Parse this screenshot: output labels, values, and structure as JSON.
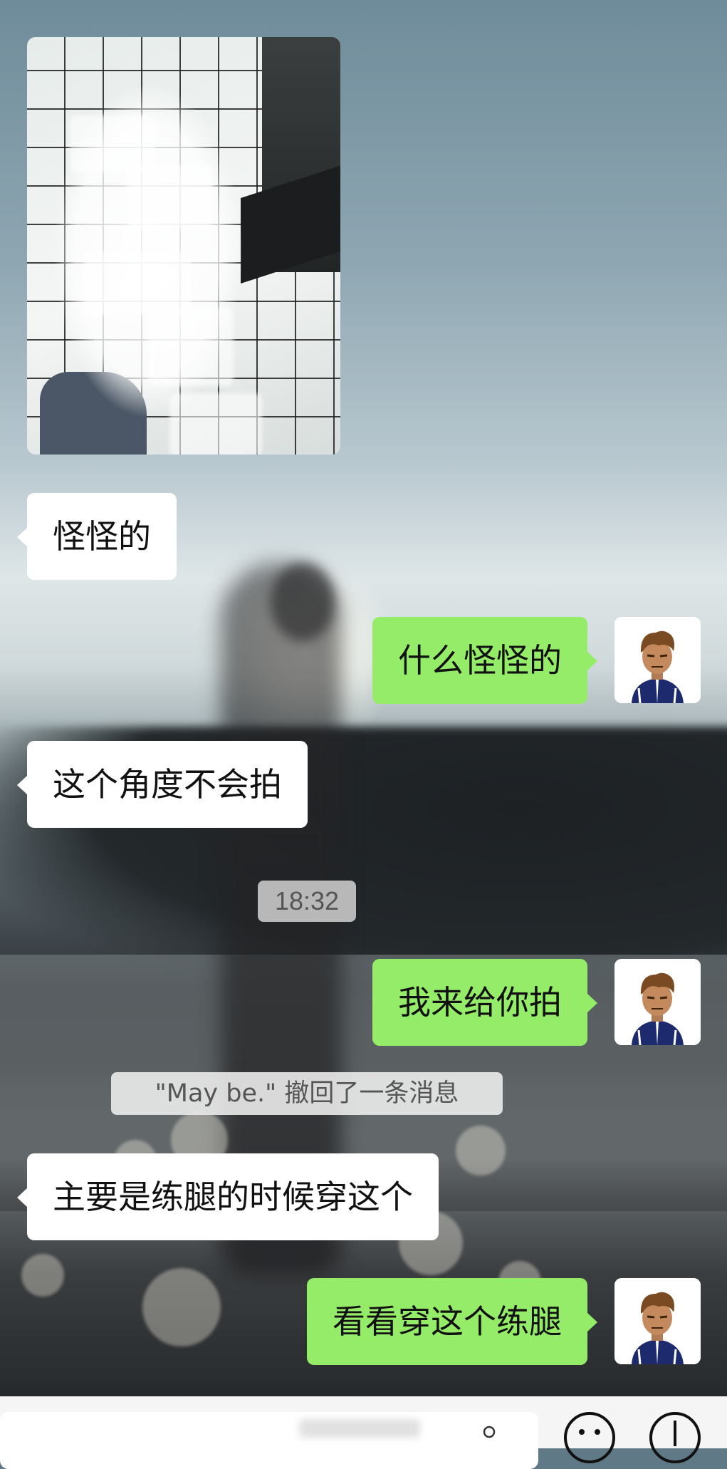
{
  "chat": {
    "messages": [
      {
        "side": "left",
        "type": "image",
        "name": "received-photo"
      },
      {
        "side": "left",
        "type": "text",
        "text": "怪怪的"
      },
      {
        "side": "right",
        "type": "text",
        "text": "什么怪怪的"
      },
      {
        "side": "left",
        "type": "text",
        "text": "这个角度不会拍"
      },
      {
        "side": "right",
        "type": "text",
        "text": "我来给你拍"
      },
      {
        "side": "left",
        "type": "text",
        "text": "主要是练腿的时候穿这个"
      },
      {
        "side": "right",
        "type": "text",
        "text": "看看穿这个练腿"
      }
    ],
    "timestamp": "18:32",
    "recall_notice": "\"May be.\" 撤回了一条消息"
  },
  "colors": {
    "sent_bubble": "#95ec69",
    "received_bubble": "#ffffff",
    "input_bar": "#f5f5f5"
  },
  "icons": {
    "voice": "microphone-icon",
    "emoji": "smiley-icon",
    "more": "plus-circle-icon"
  }
}
